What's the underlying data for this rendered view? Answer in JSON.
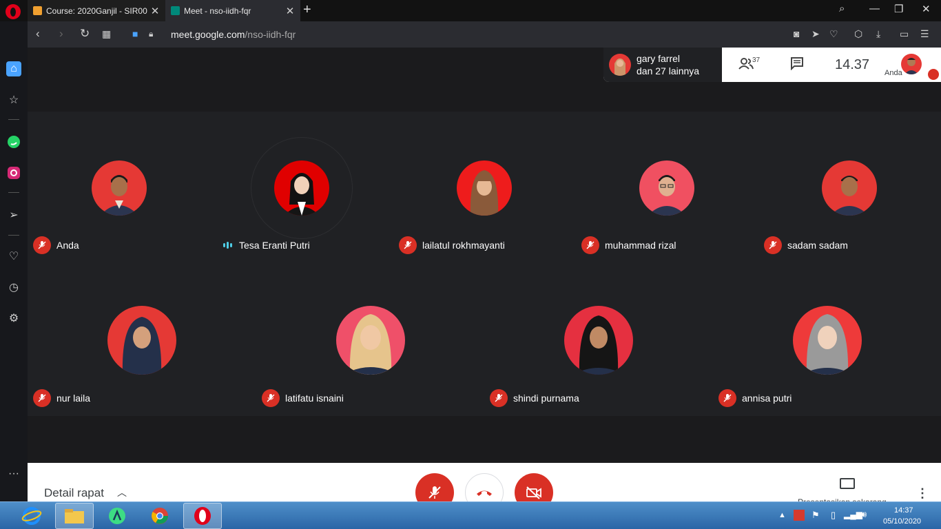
{
  "browser": {
    "tabs": [
      {
        "title": "Course: 2020Ganjil - SIR00",
        "active": false
      },
      {
        "title": "Meet - nso-iidh-fqr",
        "active": true
      }
    ],
    "url_domain": "meet.google.com",
    "url_path": "/nso-iidh-fqr"
  },
  "sidebar": {
    "items": [
      "home-icon",
      "star-icon",
      "whatsapp-icon",
      "instagram-icon",
      "send-icon",
      "heart-icon",
      "history-icon",
      "settings-icon",
      "more-icon"
    ]
  },
  "meet": {
    "top_info": {
      "presenter_name": "gary farrel",
      "presenter_more": "dan 27 lainnya",
      "people_count": "37",
      "time": "14.37",
      "self_label": "Anda"
    },
    "participants_row1": [
      {
        "name": "Anda",
        "muted": true,
        "bg": "#e53935"
      },
      {
        "name": "Tesa Eranti Putri",
        "muted": false,
        "speaking": true,
        "bg": "#e00000"
      },
      {
        "name": "lailatul rokhmayanti",
        "muted": true,
        "bg": "#ee1c1c"
      },
      {
        "name": "muhammad rizal",
        "muted": true,
        "bg": "#f05061"
      },
      {
        "name": "sadam sadam",
        "muted": true,
        "bg": "#e53935"
      }
    ],
    "participants_row2": [
      {
        "name": "nur laila",
        "muted": true,
        "bg": "#e53935"
      },
      {
        "name": "latifatu isnaini",
        "muted": true,
        "bg": "#ef5069"
      },
      {
        "name": "shindi purnama",
        "muted": true,
        "bg": "#e53040"
      },
      {
        "name": "annisa putri",
        "muted": true,
        "bg": "#ee3a3a"
      }
    ],
    "controls": {
      "details_label": "Detail rapat",
      "present_label": "Presentasikan sekarang"
    }
  },
  "taskbar": {
    "time": "14:37",
    "date": "05/10/2020"
  }
}
